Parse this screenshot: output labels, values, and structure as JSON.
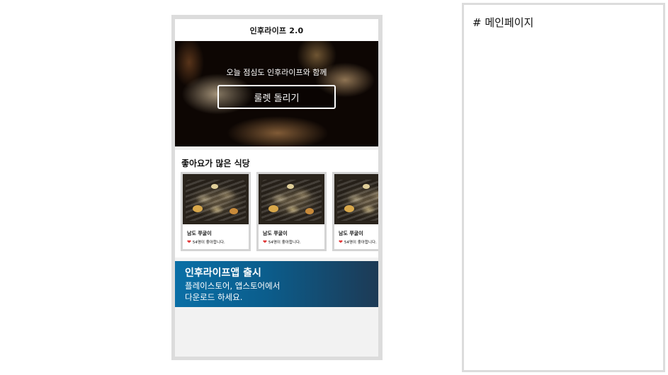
{
  "app": {
    "title": "인후라이프 2.0"
  },
  "hero": {
    "tagline": "오늘 점심도 인후라이프와 함께",
    "button_label": "룰렛 돌리기"
  },
  "popular": {
    "title": "좋아요가 많은 식당",
    "cards": [
      {
        "name": "남도 쭈굴이",
        "likes": "54명이 좋아합니다.",
        "icon": "heart-icon"
      },
      {
        "name": "남도 쭈굴이",
        "likes": "54명이 좋아합니다.",
        "icon": "heart-icon"
      },
      {
        "name": "남도 쭈굴이",
        "likes": "54명이 좋아합니다.",
        "icon": "heart-icon"
      }
    ]
  },
  "promo": {
    "title": "인후라이프앱 출시",
    "line1": "플레이스토어, 앱스토어에서",
    "line2": "다운로드 하세요."
  },
  "panel": {
    "title": "# 메인페이지"
  },
  "colors": {
    "accent_blue": "#0a6fa6",
    "heart": "#e03434",
    "frame": "#dcdcdc"
  }
}
